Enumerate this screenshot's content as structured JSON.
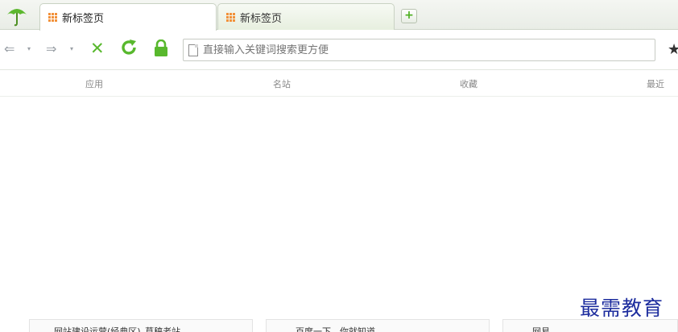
{
  "browser": {
    "tabs": [
      {
        "label": "新标签页",
        "active": true
      },
      {
        "label": "新标签页",
        "active": false
      }
    ],
    "newtab_label": "+",
    "icons": {
      "logo": "umbrella-logo-icon",
      "back": "back-arrow-icon",
      "forward": "forward-arrow-icon",
      "stop": "stop-x-icon",
      "refresh": "refresh-icon",
      "lock": "lock-icon",
      "page": "page-icon",
      "favorite": "star-icon"
    },
    "nav": {
      "back": "⇐",
      "forward": "⇒",
      "caret": "▾",
      "stop": "✕",
      "star": "★"
    },
    "address_bar": {
      "placeholder": "直接输入关键词搜索更方便"
    },
    "colors": {
      "accent": "#58b82d",
      "tab_icon": "#f2913a"
    }
  },
  "categories": [
    "应用",
    "名站",
    "收藏",
    "最近"
  ],
  "cards": [
    {
      "label": "网站建设运营(经典区)_草稿老站"
    },
    {
      "label": "百度一下，你就知道"
    },
    {
      "label": "网易"
    }
  ],
  "watermark": "最需教育"
}
